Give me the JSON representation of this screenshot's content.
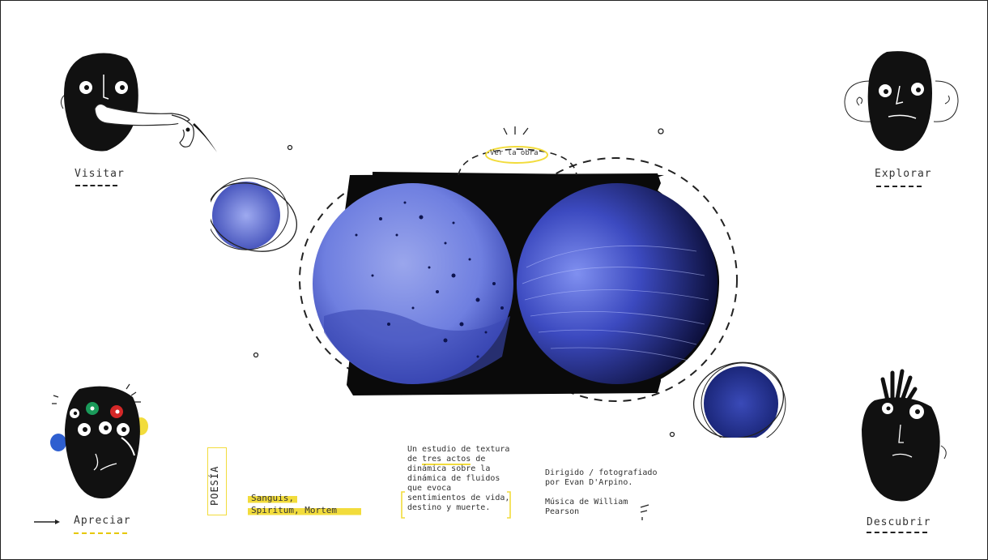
{
  "nav": {
    "visitar": "Visitar",
    "explorar": "Explorar",
    "apreciar": "Apreciar",
    "descubrir": "Descubrir"
  },
  "ver_obra": "Ver la obra",
  "poesia": "POESÍA",
  "title_line1": "Sanguis,",
  "title_line2": "Spiritum, Mortem",
  "description": {
    "l1": "Un estudio de textura",
    "l2_pre": "de ",
    "l2_hl": "tres actos",
    "l2_post": " de",
    "l3": "dinámica sobre la",
    "l4": "dinámica de fluidos",
    "l5": "que evoca",
    "l6": "sentimientos de vida,",
    "l7": "destino y muerte."
  },
  "credits": {
    "l1": "Dirigido / fotografiado",
    "l2": "por Evan D'Arpino.",
    "l3": "Música de William",
    "l4": "Pearson"
  },
  "colors": {
    "accent_yellow": "#f2dc3c",
    "blue": "#4a5bd0",
    "ink": "#111111"
  }
}
